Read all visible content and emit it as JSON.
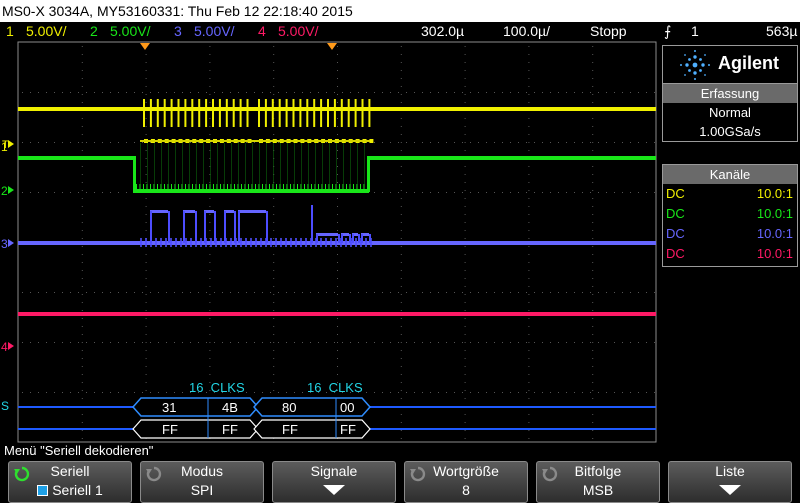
{
  "window": {
    "title": "MS0-X 3034A, MY53160331: Thu Feb 12 22:18:40 2015"
  },
  "status_row": {
    "channels": [
      {
        "num": "1",
        "scale": "5.00V/",
        "color": "#f0f000"
      },
      {
        "num": "2",
        "scale": "5.00V/",
        "color": "#19e619"
      },
      {
        "num": "3",
        "scale": "5.00V/",
        "color": "#6666ff"
      },
      {
        "num": "4",
        "scale": "5.00V/",
        "color": "#ff1a66"
      }
    ],
    "delay": "302.0µ",
    "timebase": "100.0µ/",
    "run_state": "Stopp",
    "trigger_channel": "1",
    "trigger_level": "563µ"
  },
  "scope": {
    "marker_labels": {
      "ch1": "1",
      "ch2": "2",
      "ch3": "3",
      "ch4": "4",
      "t": "T",
      "s1": "S"
    },
    "serial": {
      "clk_labels": [
        "16  CLKS",
        "16  CLKS"
      ],
      "row1": [
        "31",
        "4B",
        "80",
        "00"
      ],
      "row2": [
        "FF",
        "FF",
        "FF",
        "FF"
      ]
    }
  },
  "panel": {
    "brand": "Agilent",
    "acquisition": {
      "title": "Erfassung",
      "mode": "Normal",
      "rate": "1.00GSa/s"
    },
    "channels_title": "Kanäle",
    "channels": [
      {
        "coupling": "DC",
        "probe": "10.0:1",
        "color": "#f0f000"
      },
      {
        "coupling": "DC",
        "probe": "10.0:1",
        "color": "#19e619"
      },
      {
        "coupling": "DC",
        "probe": "10.0:1",
        "color": "#6666ff"
      },
      {
        "coupling": "DC",
        "probe": "10.0:1",
        "color": "#ff1a66"
      }
    ]
  },
  "menu": {
    "title": "Menü \"Seriell dekodieren\""
  },
  "softkeys": [
    {
      "label": "Seriell",
      "value": "Seriell 1"
    },
    {
      "label": "Modus",
      "value": "SPI"
    },
    {
      "label": "Signale",
      "value": ""
    },
    {
      "label": "Wortgröße",
      "value": "8"
    },
    {
      "label": "Bitfolge",
      "value": "MSB"
    },
    {
      "label": "Liste",
      "value": ""
    }
  ]
}
